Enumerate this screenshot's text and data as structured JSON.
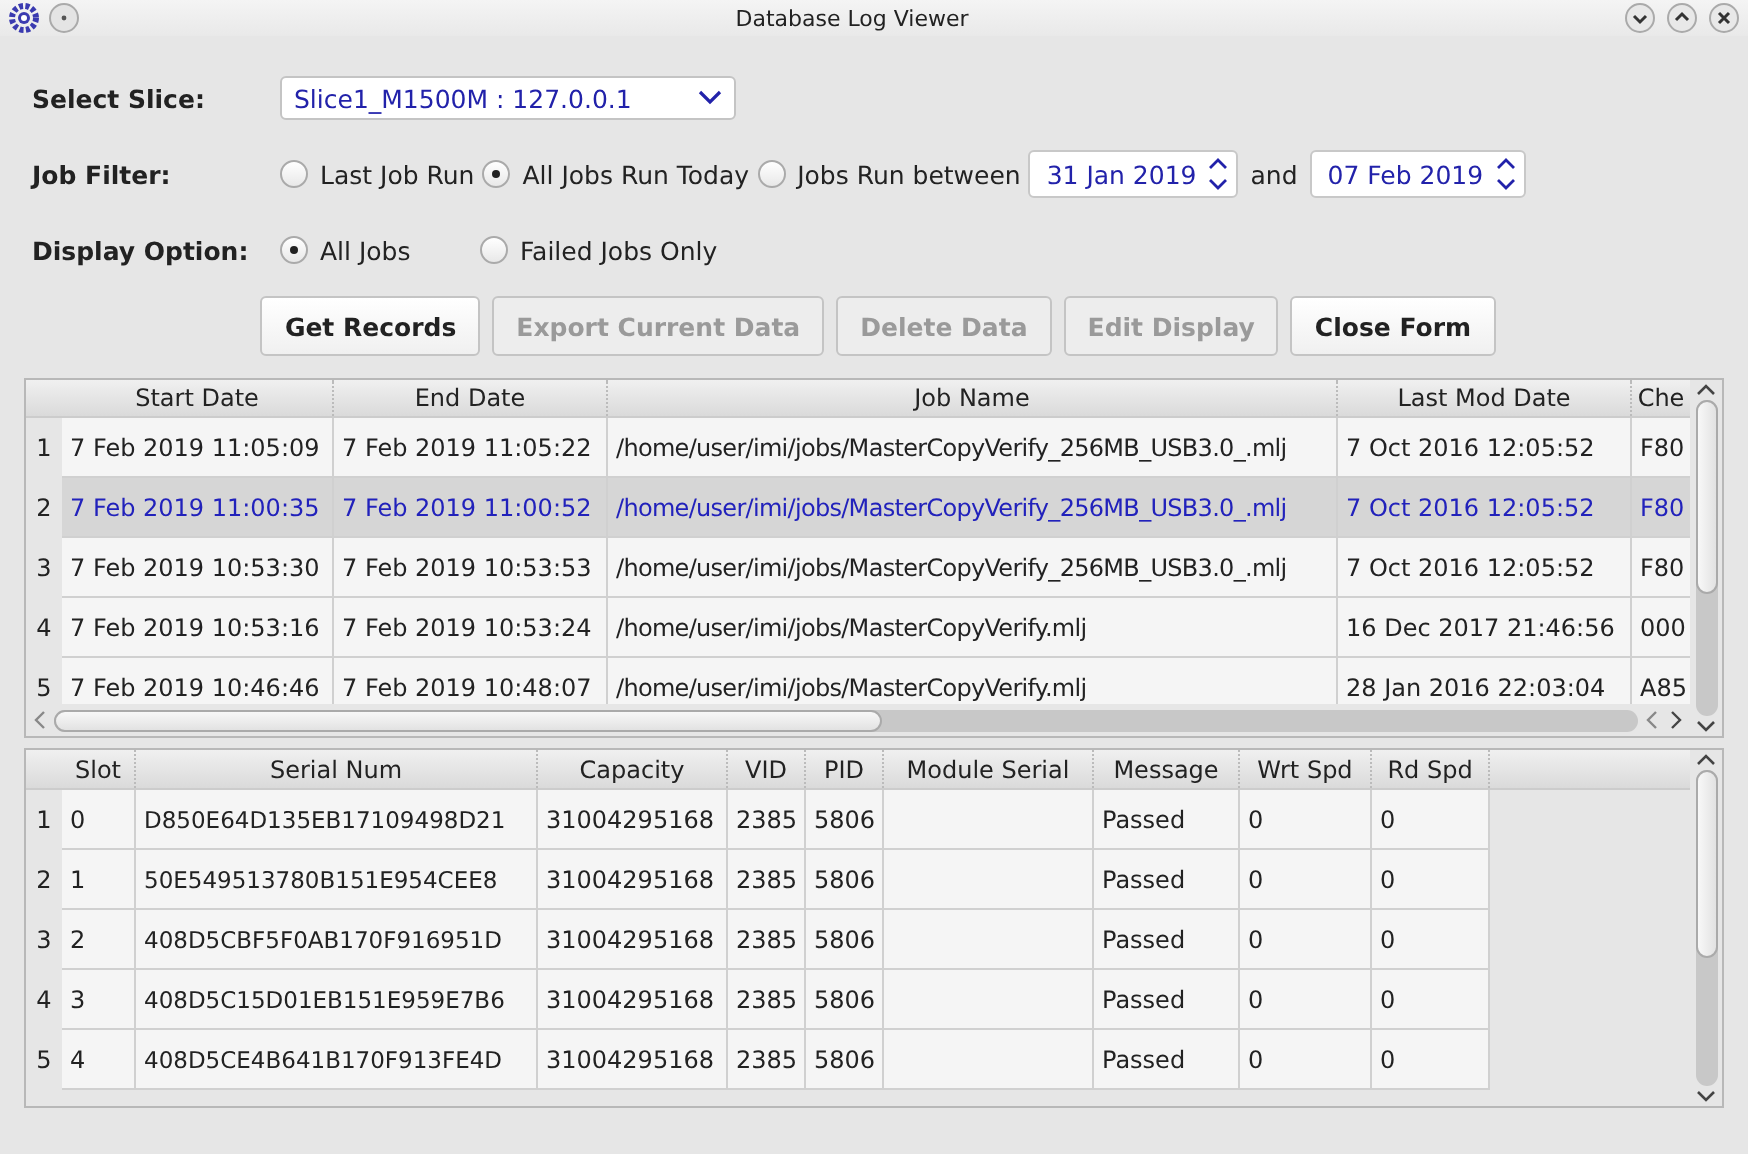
{
  "window": {
    "title": "Database Log Viewer"
  },
  "select_slice": {
    "label": "Select Slice:",
    "value": "Slice1_M1500M : 127.0.0.1"
  },
  "job_filter": {
    "label": "Job Filter:",
    "options": [
      {
        "label": "Last Job Run",
        "selected": false
      },
      {
        "label": "All Jobs Run Today",
        "selected": true
      },
      {
        "label": "Jobs Run between",
        "selected": false
      }
    ],
    "from_date": "31 Jan 2019",
    "and_label": "and",
    "to_date": "07 Feb 2019"
  },
  "display_option": {
    "label": "Display Option:",
    "options": [
      {
        "label": "All Jobs",
        "selected": true
      },
      {
        "label": "Failed Jobs Only",
        "selected": false
      }
    ]
  },
  "buttons": [
    {
      "label": "Get Records",
      "disabled": false
    },
    {
      "label": "Export Current Data",
      "disabled": true
    },
    {
      "label": "Delete Data",
      "disabled": true
    },
    {
      "label": "Edit Display",
      "disabled": true
    },
    {
      "label": "Close Form",
      "disabled": false
    }
  ],
  "jobs_table": {
    "columns": [
      "Start Date",
      "End Date",
      "Job Name",
      "Last Mod Date",
      "Che"
    ],
    "rows": [
      {
        "number": "1",
        "selected": false,
        "cells": [
          "7 Feb 2019 11:05:09",
          "7 Feb 2019 11:05:22",
          "/home/user/imi/jobs/MasterCopyVerify_256MB_USB3.0_.mlj",
          "7 Oct 2016 12:05:52",
          "F80"
        ]
      },
      {
        "number": "2",
        "selected": true,
        "cells": [
          "7 Feb 2019 11:00:35",
          "7 Feb 2019 11:00:52",
          "/home/user/imi/jobs/MasterCopyVerify_256MB_USB3.0_.mlj",
          "7 Oct 2016 12:05:52",
          "F80"
        ]
      },
      {
        "number": "3",
        "selected": false,
        "cells": [
          "7 Feb 2019 10:53:30",
          "7 Feb 2019 10:53:53",
          "/home/user/imi/jobs/MasterCopyVerify_256MB_USB3.0_.mlj",
          "7 Oct 2016 12:05:52",
          "F80"
        ]
      },
      {
        "number": "4",
        "selected": false,
        "cells": [
          "7 Feb 2019 10:53:16",
          "7 Feb 2019 10:53:24",
          "/home/user/imi/jobs/MasterCopyVerify.mlj",
          "16 Dec 2017 21:46:56",
          "000"
        ]
      },
      {
        "number": "5",
        "selected": false,
        "cells": [
          "7 Feb 2019 10:46:46",
          "7 Feb 2019 10:48:07",
          "/home/user/imi/jobs/MasterCopyVerify.mlj",
          "28 Jan 2016 22:03:04",
          "A85"
        ]
      }
    ]
  },
  "slots_table": {
    "columns": [
      "Slot",
      "Serial Num",
      "Capacity",
      "VID",
      "PID",
      "Module Serial",
      "Message",
      "Wrt Spd",
      "Rd Spd"
    ],
    "rows": [
      {
        "number": "1",
        "cells": [
          "0",
          "D850E64D135EB17109498D21",
          "31004295168",
          "2385",
          "5806",
          null,
          "Passed",
          "0",
          "0"
        ]
      },
      {
        "number": "2",
        "cells": [
          "1",
          "50E549513780B151E954CEE8",
          "31004295168",
          "2385",
          "5806",
          null,
          "Passed",
          "0",
          "0"
        ]
      },
      {
        "number": "3",
        "cells": [
          "2",
          "408D5CBF5F0AB170F916951D",
          "31004295168",
          "2385",
          "5806",
          null,
          "Passed",
          "0",
          "0"
        ]
      },
      {
        "number": "4",
        "cells": [
          "3",
          "408D5C15D01EB151E959E7B6",
          "31004295168",
          "2385",
          "5806",
          null,
          "Passed",
          "0",
          "0"
        ]
      },
      {
        "number": "5",
        "cells": [
          "4",
          "408D5CE4B641B170F913FE4D",
          "31004295168",
          "2385",
          "5806",
          null,
          "Passed",
          "0",
          "0"
        ]
      }
    ]
  }
}
